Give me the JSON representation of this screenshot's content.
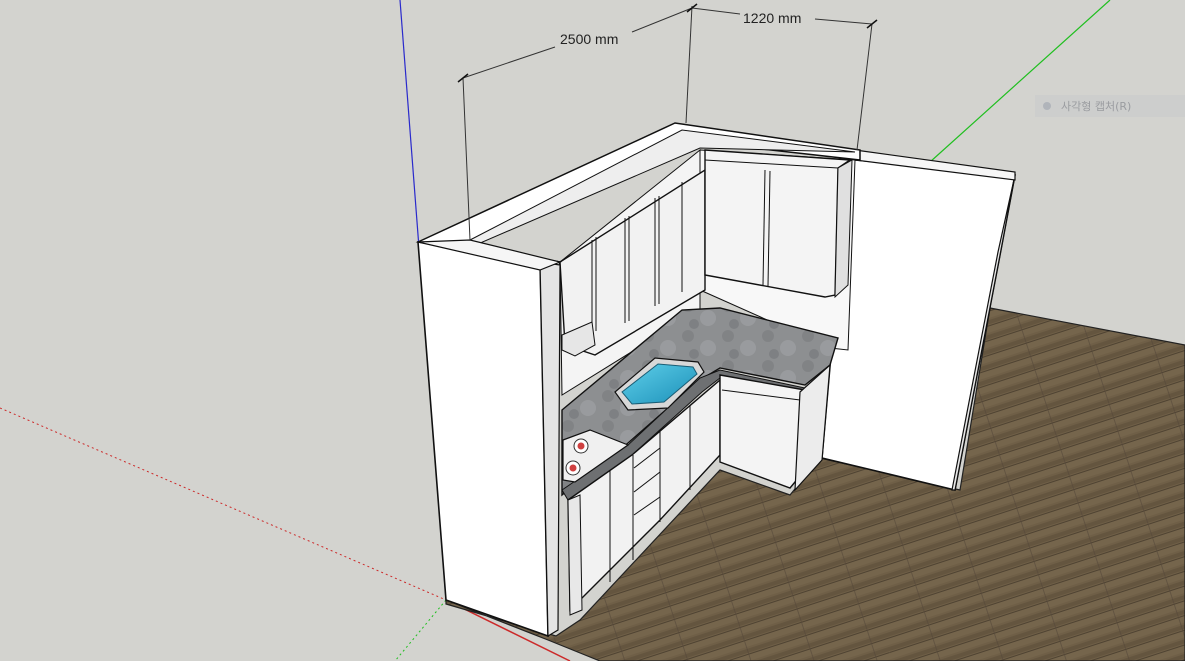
{
  "viewport": {
    "dimensions": [
      {
        "label": "2500 mm"
      },
      {
        "label": "1220 mm"
      }
    ],
    "capture_hint": {
      "label": "사각형 캡처(R)",
      "icon": "capture-dot-icon"
    },
    "colors": {
      "background": "#d3d3cf",
      "axis_red": "#cc2a2a",
      "axis_green": "#1fbf1f",
      "axis_blue": "#2a2acc",
      "countertop": "#8a8c8e",
      "sink_water": "#2fa6c8",
      "floor": "#6e5e46",
      "cabinet": "#f2f2f2",
      "wall": "#ffffff"
    }
  }
}
